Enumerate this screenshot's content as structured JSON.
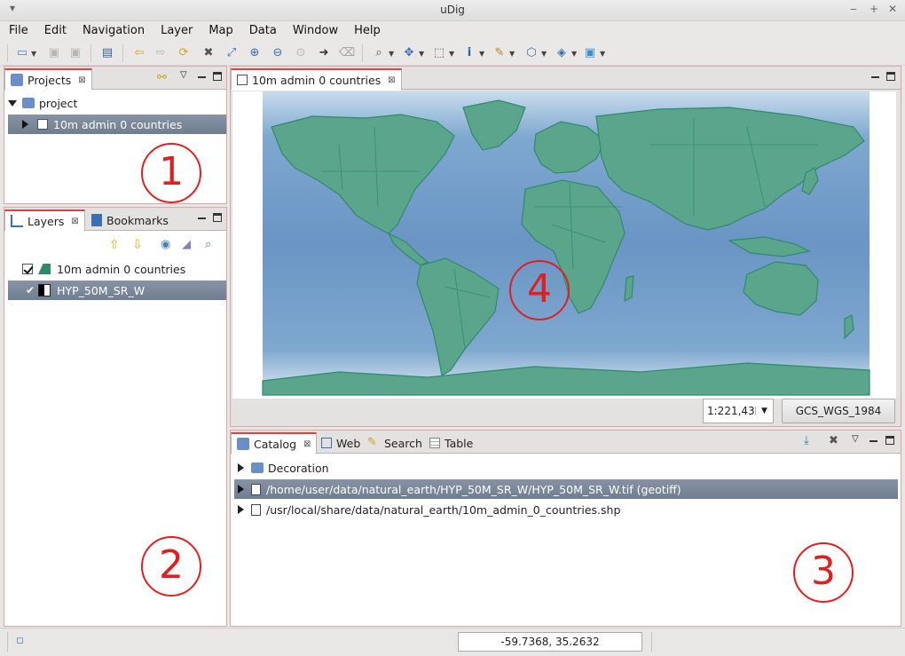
{
  "window": {
    "title": "uDig"
  },
  "menu": [
    "File",
    "Edit",
    "Navigation",
    "Layer",
    "Map",
    "Data",
    "Window",
    "Help"
  ],
  "projects": {
    "tab_label": "Projects",
    "root": "project",
    "child": "10m admin 0 countries"
  },
  "layers": {
    "tab_label": "Layers",
    "bookmarks_label": "Bookmarks",
    "items": [
      "10m admin 0 countries",
      "HYP_50M_SR_W"
    ]
  },
  "map": {
    "tab_label": "10m admin 0 countries",
    "scale": "1:221,43",
    "crs": "GCS_WGS_1984"
  },
  "catalog": {
    "tabs": [
      "Catalog",
      "Web",
      "Search",
      "Table"
    ],
    "items": [
      "Decoration",
      "/home/user/data/natural_earth/HYP_50M_SR_W/HYP_50M_SR_W.tif (geotiff)",
      "/usr/local/share/data/natural_earth/10m_admin_0_countries.shp"
    ]
  },
  "status": {
    "coordinates": "-59.7368, 35.2632"
  },
  "annotations": [
    "1",
    "2",
    "3",
    "4"
  ],
  "colors": {
    "selection": "#7a889b",
    "ocean": "#6f9ac7",
    "land": "#4f9e84",
    "accent_red": "#e02020"
  }
}
